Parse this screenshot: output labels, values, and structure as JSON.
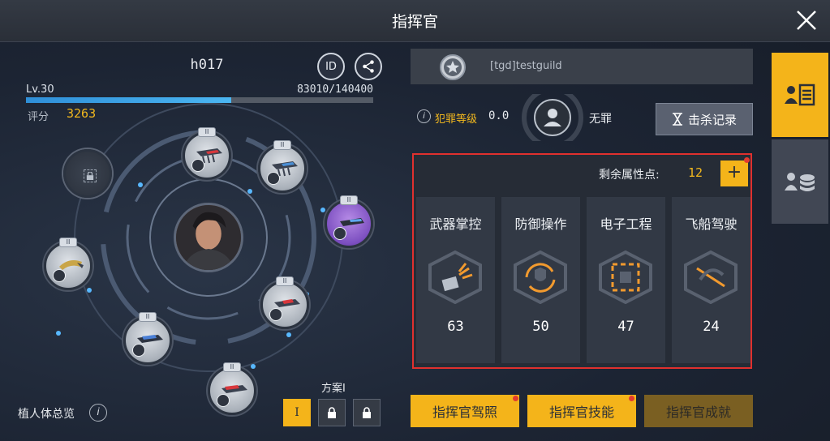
{
  "window": {
    "title": "指挥官"
  },
  "player": {
    "name": "h017",
    "id_label": "ID",
    "level_label": "Lv.30",
    "exp_text": "83010/140400",
    "exp_fraction": 0.591,
    "score_label": "评分",
    "score_value": "3263"
  },
  "implants": {
    "overview_label": "植人体总览",
    "info_glyph": "i",
    "tier_label": "II",
    "plan_label": "方案I",
    "plan_buttons": [
      {
        "label": "I",
        "state": "active"
      },
      {
        "icon": "lock-icon",
        "state": "locked"
      },
      {
        "icon": "lock-icon",
        "state": "locked"
      }
    ]
  },
  "guild": {
    "name": "[tgd]testguild",
    "icon": "star-badge-icon"
  },
  "crime": {
    "info_glyph": "i",
    "label": "犯罪等级",
    "level": "0.0",
    "status": "无罪",
    "kill_record_label": "击杀记录"
  },
  "attributes": {
    "remaining_label": "剩余属性点:",
    "remaining_value": "12",
    "plus_label": "+",
    "items": [
      {
        "name": "武器掌控",
        "value": "63",
        "icon": "weapon-control-icon"
      },
      {
        "name": "防御操作",
        "value": "50",
        "icon": "defense-operation-icon"
      },
      {
        "name": "电子工程",
        "value": "47",
        "icon": "electronic-engineering-icon"
      },
      {
        "name": "飞船驾驶",
        "value": "24",
        "icon": "ship-piloting-icon"
      }
    ]
  },
  "bottom_buttons": [
    {
      "label": "指挥官驾照"
    },
    {
      "label": "指挥官技能"
    },
    {
      "label": "指挥官成就"
    }
  ],
  "colors": {
    "accent": "#f4b41a",
    "exp_blue": "#3aa4e6",
    "alert_red": "#e0302e",
    "score_gold": "#f2b81e"
  }
}
